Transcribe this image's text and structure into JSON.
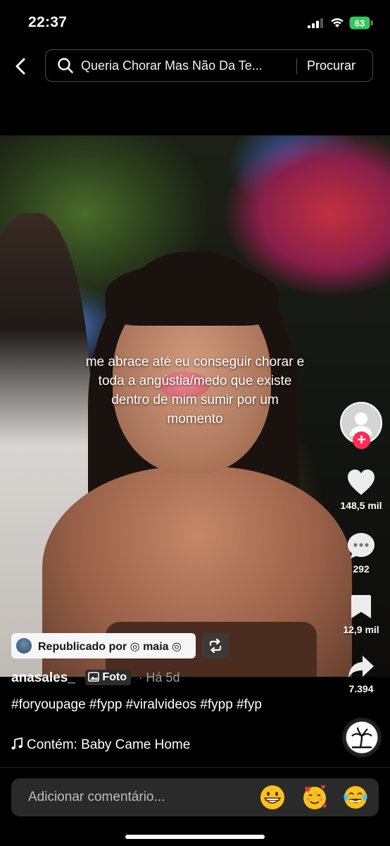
{
  "status_bar": {
    "time": "22:37",
    "battery": "63"
  },
  "search": {
    "query": "Queria Chorar Mas Não Da Te...",
    "submit_label": "Procurar"
  },
  "post": {
    "caption": "me abrace até eu conseguir chorar e toda a angústia/medo que existe dentro de mim sumir por um momento",
    "repost_label": "Republicado por ◎ maia ◎",
    "username": "anasales_",
    "type_badge": "Foto",
    "time_ago": "· Há 5d",
    "hashtags": "#foryoupage #fypp #viralvideos #fypp #fyp",
    "music": "Contém: Baby Came Home"
  },
  "actions": {
    "likes": "148,5 mil",
    "comments": "292",
    "saves": "12,9 mil",
    "shares": "7.394"
  },
  "comment_bar": {
    "placeholder": "Adicionar comentário...",
    "emojis": [
      "grinning-face",
      "smiling-face-with-hearts",
      "face-with-tears-of-joy"
    ]
  },
  "colors": {
    "follow_accent": "#fe2c55",
    "battery_green": "#34c759",
    "background": "#000000"
  }
}
